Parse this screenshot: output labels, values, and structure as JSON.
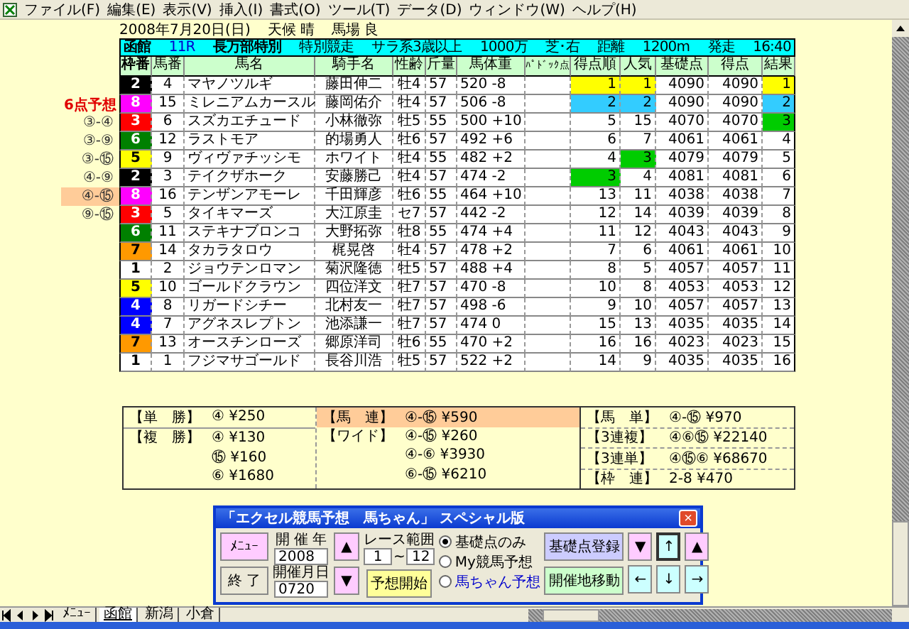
{
  "menu_bar": {
    "items": [
      "ファイル(F)",
      "編集(E)",
      "表示(V)",
      "挿入(I)",
      "書式(O)",
      "ツール(T)",
      "データ(D)",
      "ウィンドウ(W)",
      "ヘルプ(H)"
    ]
  },
  "date_line": [
    "2008年7月20日(日)",
    "天候 晴",
    "馬場 良"
  ],
  "race_header": {
    "venue": "函館",
    "race_no": "11R",
    "race_name": "長万部特別",
    "race_type": "特別競走",
    "class": "サラ系3歳以上",
    "prize": "1000万",
    "course": "芝･右",
    "distance_label": "距離",
    "distance": "1200m",
    "start_label": "発走",
    "start_time": "16:40"
  },
  "columns": [
    "枠番",
    "馬番",
    "馬名",
    "騎手名",
    "性齢",
    "斤量",
    "馬体重",
    "ﾊﾟﾄﾞｯｸ点",
    "得点順",
    "人気",
    "基礎点",
    "得点",
    "結果"
  ],
  "prediction": {
    "title": "6点予想",
    "combos": [
      {
        "text": "③-④",
        "selected": false
      },
      {
        "text": "③-⑨",
        "selected": false
      },
      {
        "text": "③-⑮",
        "selected": false
      },
      {
        "text": "④-⑨",
        "selected": false
      },
      {
        "text": "④-⑮",
        "selected": true
      },
      {
        "text": "⑨-⑮",
        "selected": false
      }
    ]
  },
  "rows": [
    {
      "frame": "2",
      "color": "#000000",
      "num": "4",
      "name": "マヤノツルギ",
      "jockey": "藤田伸二",
      "sex_age": "牡4",
      "weight": "57",
      "body": "520 -8",
      "rank": {
        "text": "1",
        "color": "#ffff00"
      },
      "pop": {
        "text": "1",
        "color": "#ffff00"
      },
      "base": "4090",
      "score": "4090",
      "result": {
        "text": "1",
        "color": "#ffff00"
      }
    },
    {
      "frame": "8",
      "color": "#ff00ff",
      "num": "15",
      "name": "ミレニアムカースル",
      "jockey": "藤岡佑介",
      "sex_age": "牡4",
      "weight": "57",
      "body": "506 -8",
      "rank": {
        "text": "2",
        "color": "#33ccff"
      },
      "pop": {
        "text": "2",
        "color": "#33ccff"
      },
      "base": "4090",
      "score": "4090",
      "result": {
        "text": "2",
        "color": "#33ccff"
      }
    },
    {
      "frame": "3",
      "color": "#ff0000",
      "num": "6",
      "name": "スズカエチュード",
      "jockey": "小林徹弥",
      "sex_age": "牡5",
      "weight": "55",
      "body": "500 +10",
      "rank": {
        "text": "5"
      },
      "pop": {
        "text": "15"
      },
      "base": "4070",
      "score": "4070",
      "result": {
        "text": "3",
        "color": "#00cc00"
      }
    },
    {
      "frame": "6",
      "color": "#008000",
      "num": "12",
      "name": "ラストモア",
      "jockey": "的場勇人",
      "sex_age": "牡6",
      "weight": "57",
      "body": "492 +6",
      "rank": {
        "text": "6"
      },
      "pop": {
        "text": "7"
      },
      "base": "4061",
      "score": "4061",
      "result": {
        "text": "4"
      }
    },
    {
      "frame": "5",
      "color": "#ffff00",
      "num": "9",
      "name": "ヴィヴァチッシモ",
      "jockey": "ホワイト",
      "sex_age": "牡4",
      "weight": "55",
      "body": "482 +2",
      "rank": {
        "text": "4"
      },
      "pop": {
        "text": "3",
        "color": "#00cc00"
      },
      "base": "4079",
      "score": "4079",
      "result": {
        "text": "5"
      }
    },
    {
      "frame": "2",
      "color": "#000000",
      "num": "3",
      "name": "テイクザホーク",
      "jockey": "安藤勝己",
      "sex_age": "牡4",
      "weight": "57",
      "body": "474 -2",
      "rank": {
        "text": "3",
        "color": "#00cc00"
      },
      "pop": {
        "text": "4"
      },
      "base": "4081",
      "score": "4081",
      "result": {
        "text": "6"
      }
    },
    {
      "frame": "8",
      "color": "#ff00ff",
      "num": "16",
      "name": "テンザンアモーレ",
      "jockey": "千田輝彦",
      "sex_age": "牡6",
      "weight": "55",
      "body": "464 +10",
      "rank": {
        "text": "13"
      },
      "pop": {
        "text": "11"
      },
      "base": "4038",
      "score": "4038",
      "result": {
        "text": "7"
      }
    },
    {
      "frame": "3",
      "color": "#ff0000",
      "num": "5",
      "name": "タイキマーズ",
      "jockey": "大江原圭",
      "sex_age": "セ7",
      "weight": "57",
      "body": "442 -2",
      "rank": {
        "text": "12"
      },
      "pop": {
        "text": "14"
      },
      "base": "4039",
      "score": "4039",
      "result": {
        "text": "8"
      }
    },
    {
      "frame": "6",
      "color": "#008000",
      "num": "11",
      "name": "ステキナブロンコ",
      "jockey": "大野拓弥",
      "sex_age": "牡8",
      "weight": "55",
      "body": "474 +4",
      "rank": {
        "text": "11"
      },
      "pop": {
        "text": "12"
      },
      "base": "4043",
      "score": "4043",
      "result": {
        "text": "9"
      }
    },
    {
      "frame": "7",
      "color": "#ff9900",
      "num": "14",
      "name": "タカラタロウ",
      "jockey": "梶晃啓",
      "sex_age": "牡4",
      "weight": "57",
      "body": "478 +2",
      "rank": {
        "text": "7"
      },
      "pop": {
        "text": "6"
      },
      "base": "4061",
      "score": "4061",
      "result": {
        "text": "10"
      }
    },
    {
      "frame": "1",
      "color": "#ffffff",
      "num": "2",
      "name": "ジョウテンロマン",
      "jockey": "菊沢隆徳",
      "sex_age": "牡5",
      "weight": "57",
      "body": "488 +4",
      "rank": {
        "text": "8"
      },
      "pop": {
        "text": "5"
      },
      "base": "4057",
      "score": "4057",
      "result": {
        "text": "11"
      }
    },
    {
      "frame": "5",
      "color": "#ffff00",
      "num": "10",
      "name": "ゴールドクラウン",
      "jockey": "四位洋文",
      "sex_age": "牡7",
      "weight": "57",
      "body": "470 -8",
      "rank": {
        "text": "10"
      },
      "pop": {
        "text": "8"
      },
      "base": "4053",
      "score": "4053",
      "result": {
        "text": "12"
      }
    },
    {
      "frame": "4",
      "color": "#0000ff",
      "num": "8",
      "name": "リガードシチー",
      "jockey": "北村友一",
      "sex_age": "牡7",
      "weight": "57",
      "body": "498 -6",
      "rank": {
        "text": "9"
      },
      "pop": {
        "text": "10"
      },
      "base": "4057",
      "score": "4057",
      "result": {
        "text": "13"
      }
    },
    {
      "frame": "4",
      "color": "#0000ff",
      "num": "7",
      "name": "アグネスレプトン",
      "jockey": "池添謙一",
      "sex_age": "牡7",
      "weight": "57",
      "body": "474 0",
      "rank": {
        "text": "15"
      },
      "pop": {
        "text": "13"
      },
      "base": "4035",
      "score": "4035",
      "result": {
        "text": "14"
      }
    },
    {
      "frame": "7",
      "color": "#ff9900",
      "num": "13",
      "name": "オースチンローズ",
      "jockey": "郷原洋司",
      "sex_age": "牡6",
      "weight": "55",
      "body": "470 +2",
      "rank": {
        "text": "16"
      },
      "pop": {
        "text": "16"
      },
      "base": "4023",
      "score": "4023",
      "result": {
        "text": "15"
      }
    },
    {
      "frame": "1",
      "color": "#ffffff",
      "num": "1",
      "name": "フジマサゴールド",
      "jockey": "長谷川浩",
      "sex_age": "牡5",
      "weight": "57",
      "body": "522 +2",
      "rank": {
        "text": "14"
      },
      "pop": {
        "text": "9"
      },
      "base": "4035",
      "score": "4035",
      "result": {
        "text": "16"
      }
    }
  ],
  "payouts": [
    [
      {
        "label": "【単　勝】",
        "value": "④ ¥250",
        "highlighted": false
      },
      {
        "label": "【複　勝】",
        "value": "④ ¥130",
        "highlighted": false
      },
      {
        "value": "⑮ ¥160",
        "highlighted": false
      },
      {
        "value": "⑥ ¥1680",
        "highlighted": false
      }
    ],
    [
      {
        "label": "【馬　連】",
        "value": "④-⑮ ¥590",
        "highlighted": true
      },
      {
        "label": "【ワイド】",
        "value": "④-⑮ ¥260",
        "highlighted": false
      },
      {
        "value": "④-⑥ ¥3930",
        "highlighted": false
      },
      {
        "value": "⑥-⑮ ¥6210",
        "highlighted": false
      }
    ],
    [
      {
        "label": "【馬　単】",
        "value": "④-⑮ ¥970",
        "highlighted": false
      },
      {
        "label": "【3連複】",
        "value": "④⑥⑮ ¥22140",
        "highlighted": false
      },
      {
        "label": "【3連単】",
        "value": "④⑮⑥ ¥68670",
        "highlighted": false
      },
      {
        "label": "【枠　連】",
        "value": "2-8 ¥470",
        "highlighted": false
      }
    ]
  ],
  "dialog": {
    "title": "「エクセル競馬予想　馬ちゃん」 スペシャル版",
    "close": "×",
    "menu_button": "ﾒﾆｭｰ",
    "exit_button": "終 了",
    "year_label": "開 催 年",
    "year": "2008",
    "date_label": "開催月日",
    "date": "0720",
    "up": "▲",
    "down": "▼",
    "range_label": "レース範囲",
    "range_from": "1",
    "range_sep": "~",
    "range_to": "12",
    "start_button": "予想開始",
    "modes": [
      {
        "label": "基礎点のみ",
        "selected": true
      },
      {
        "label": "My競馬予想",
        "selected": false
      },
      {
        "label": "馬ちゃん予想",
        "selected": false
      }
    ],
    "register_button": "基礎点登録",
    "move_button": "開催地移動",
    "nav": [
      {
        "label": "▼",
        "kind": "pink",
        "selected": false
      },
      {
        "label": "↑",
        "kind": "cyan",
        "selected": true
      },
      {
        "label": "▲",
        "kind": "pink",
        "selected": false
      },
      {
        "label": "←",
        "kind": "cyan",
        "selected": false
      },
      {
        "label": "↓",
        "kind": "cyan",
        "selected": false
      },
      {
        "label": "→",
        "kind": "cyan",
        "selected": false
      }
    ]
  },
  "sheet_tabs": [
    {
      "label": "ﾒﾆｭｰ",
      "selected": false
    },
    {
      "label": "函館",
      "selected": true
    },
    {
      "label": "新潟",
      "selected": false
    },
    {
      "label": "小倉",
      "selected": false
    }
  ]
}
